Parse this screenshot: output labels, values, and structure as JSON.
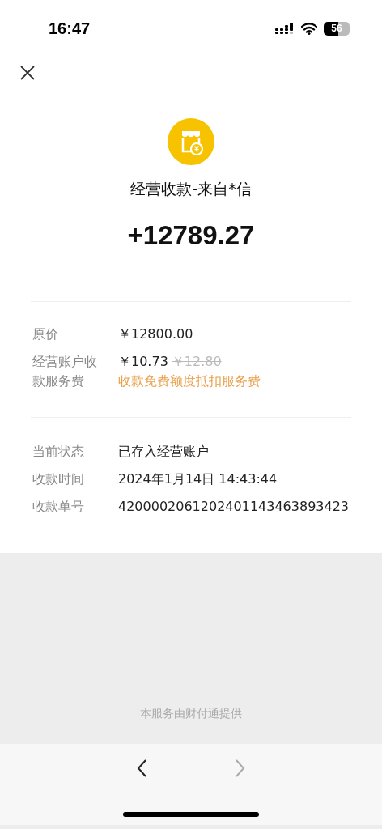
{
  "status_bar": {
    "time": "16:47",
    "battery": "56"
  },
  "header": {
    "title": "经营收款-来自*信",
    "amount": "+12789.27"
  },
  "sections": [
    {
      "rows": [
        {
          "kind": "plain",
          "label": "原价",
          "value": "￥12800.00"
        },
        {
          "kind": "fee",
          "label": "经营账户收款服务费",
          "value": "￥10.73",
          "original": "￥12.80",
          "note": "收款免费额度抵扣服务费"
        }
      ]
    },
    {
      "rows": [
        {
          "kind": "plain",
          "label": "当前状态",
          "value": "已存入经营账户"
        },
        {
          "kind": "plain",
          "label": "收款时间",
          "value": "2024年1月14日 14:43:44"
        },
        {
          "kind": "plain",
          "label": "收款单号",
          "value": "4200002061202401143463893423"
        }
      ]
    }
  ],
  "footer": {
    "text": "本服务由财付通提供"
  },
  "nav": [
    {
      "kind": "back",
      "disabled": false
    },
    {
      "kind": "forward",
      "disabled": true
    }
  ]
}
